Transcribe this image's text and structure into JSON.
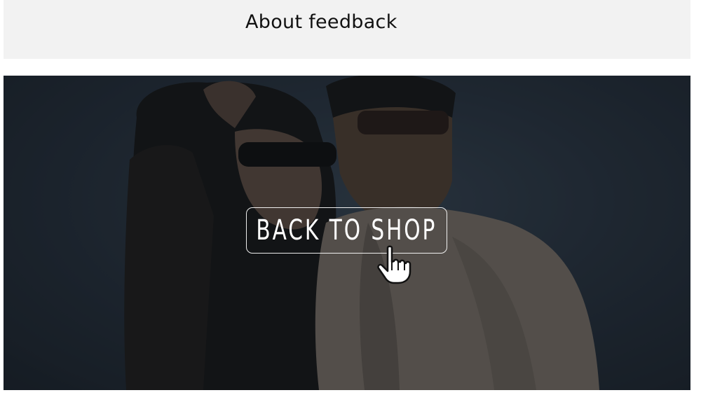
{
  "header": {
    "title": "About feedback"
  },
  "banner": {
    "button_label": "BACK TO SHOP",
    "cursor_icon": "pointer-hand-icon",
    "image_subject": "couple-in-sunglasses-photo"
  },
  "colors": {
    "header_background": "#f2f2f2",
    "banner_overlay": "#1b232d",
    "button_text": "#ffffff"
  }
}
